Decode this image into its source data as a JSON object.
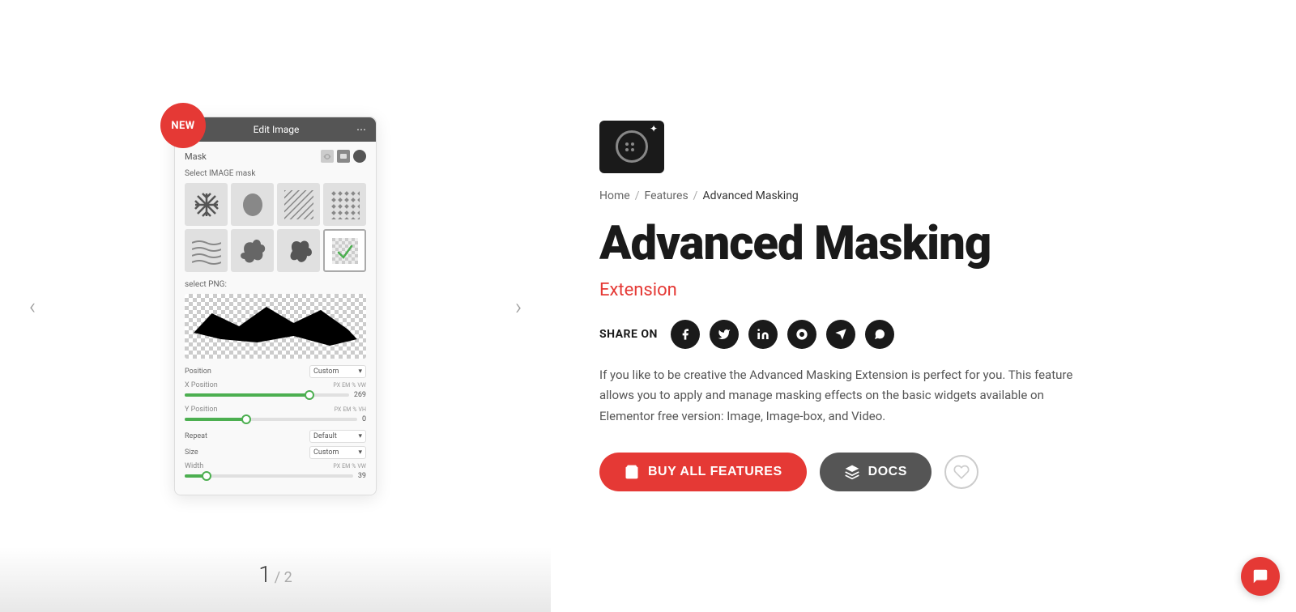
{
  "new_badge": "NEW",
  "phone_header_title": "Edit Image",
  "mask_label": "Mask",
  "select_image_mask_label": "Select IMAGE mask",
  "select_png_label": "select PNG:",
  "position_label": "Position",
  "position_value": "Custom",
  "x_position_label": "X Position",
  "x_position_value": "269",
  "x_slider_percent": 75,
  "y_position_label": "Y Position",
  "y_position_value": "0",
  "y_slider_percent": 35,
  "repeat_label": "Repeat",
  "repeat_value": "Default",
  "size_label": "Size",
  "size_value": "Custom",
  "width_label": "Width",
  "width_value": "39",
  "width_slider_percent": 12,
  "breadcrumb": {
    "home": "Home",
    "features": "Features",
    "current": "Advanced Masking",
    "sep": "/"
  },
  "page_title": "Advanced Masking",
  "extension_label": "Extension",
  "share_label": "SHARE ON",
  "description": "If you like to be creative the Advanced Masking Extension is perfect for you. This feature allows you to apply and manage masking effects on the basic widgets available on Elementor free version: Image, Image-box, and Video.",
  "buy_btn_label": "BUY ALL FEATURES",
  "docs_btn_label": "DOCS",
  "page_current": "1",
  "page_total": "/ 2",
  "social_icons": [
    {
      "name": "facebook-icon",
      "symbol": "f"
    },
    {
      "name": "twitter-icon",
      "symbol": "t"
    },
    {
      "name": "linkedin-icon",
      "symbol": "in"
    },
    {
      "name": "skype-icon",
      "symbol": "S"
    },
    {
      "name": "telegram-icon",
      "symbol": "✈"
    },
    {
      "name": "whatsapp-icon",
      "symbol": "W"
    }
  ],
  "mask_patterns": [
    "snowflake",
    "circle",
    "diagonal-lines",
    "diamond-pattern",
    "wave-lines",
    "splatter1",
    "splatter2",
    "selected-box"
  ]
}
